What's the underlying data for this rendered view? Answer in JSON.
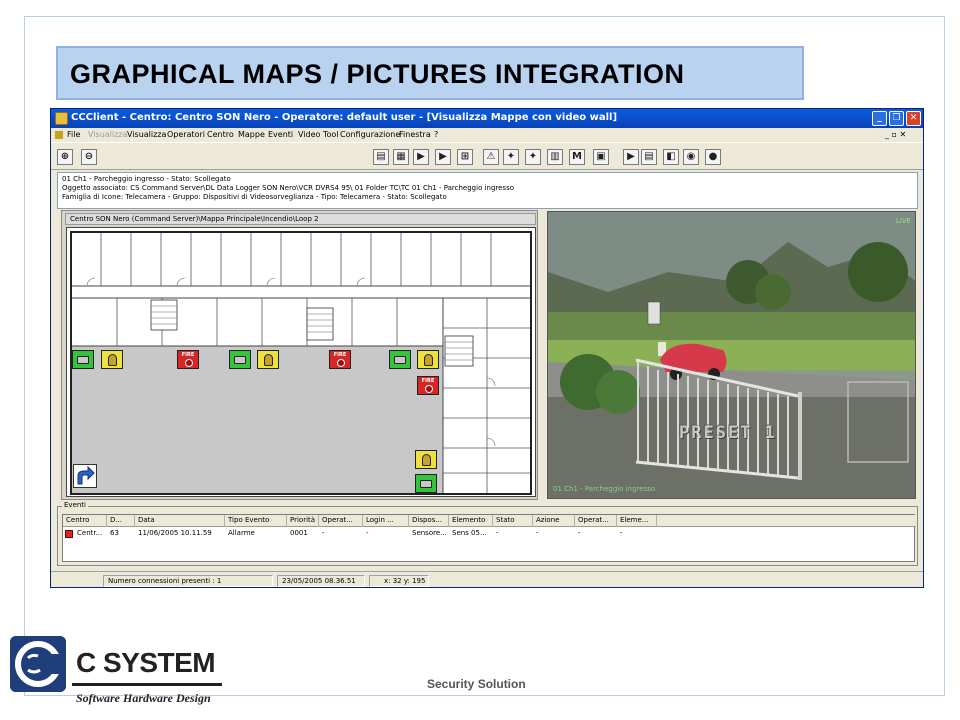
{
  "slide": {
    "title": "GRAPHICAL  MAPS / PICTURES INTEGRATION",
    "footer": "Security  Solution"
  },
  "logo": {
    "brand": "C SYSTEM",
    "tagline": "Software Hardware Design"
  },
  "window": {
    "title": "CCClient - Centro: Centro SON Nero - Operatore: default user - [Visualizza Mappe con video wall]",
    "minimize": "_",
    "restore": "❐",
    "close": "✕"
  },
  "menu": {
    "items": [
      "File",
      "Visualizza",
      "Visualizza",
      "Operatori",
      "Centro",
      "Mappe",
      "Eventi",
      "Video Tool",
      "Configurazione",
      "Finestra",
      "?"
    ],
    "mdi_controls": "_ ▫ ✕"
  },
  "toolbar": {
    "buttons": [
      {
        "icon": "zoom-in-icon",
        "glyph": "⊕"
      },
      {
        "icon": "zoom-out-icon",
        "glyph": "⊖"
      },
      {
        "icon": "document-icon",
        "glyph": "▤"
      },
      {
        "icon": "map-view-icon",
        "glyph": "▦"
      },
      {
        "icon": "camera-group-icon",
        "glyph": "▶"
      },
      {
        "icon": "camera-group-2-icon",
        "glyph": "▶"
      },
      {
        "icon": "grid-icon",
        "glyph": "⊞"
      },
      {
        "icon": "alarm-icon",
        "glyph": "⚠"
      },
      {
        "icon": "camera-alarm-icon",
        "glyph": "✦"
      },
      {
        "icon": "camera-alarm-2-icon",
        "glyph": "✦"
      },
      {
        "icon": "report-icon",
        "glyph": "▥"
      },
      {
        "icon": "ma-icon",
        "glyph": "M"
      },
      {
        "icon": "monitor-icon",
        "glyph": "▣"
      },
      {
        "icon": "play-icon",
        "glyph": "▶"
      },
      {
        "icon": "film-icon",
        "glyph": "▤"
      },
      {
        "icon": "palette-icon",
        "glyph": "◧"
      },
      {
        "icon": "record-icon",
        "glyph": "◉"
      },
      {
        "icon": "sphere-icon",
        "glyph": "●"
      }
    ]
  },
  "info": {
    "lines": [
      "01 Ch1 - Parcheggio ingresso - Stato: Scollegato",
      "Oggetto associato: CS Command Server\\DL Data Logger SON Nero\\VCR DVRS4 95\\ 01 Folder TC\\TC 01 Ch1 - Parcheggio ingresso",
      "Famiglia di Icone: Telecamera - Gruppo: Dispositivi di Videosorveglianza - Tipo: Telecamera - Stato: Scollegato"
    ]
  },
  "map": {
    "breadcrumb": "Centro SON Nero (Command Server)\\Mappa Principale\\Incendio\\Loop 2",
    "fire_label": "FIRE"
  },
  "video": {
    "live_label": "LIVE",
    "preset_label": "PRESET  1",
    "caption": "01 Ch1 - Parcheggio ingresso"
  },
  "events": {
    "legend": "Eventi",
    "columns": [
      "Centro",
      "D...",
      "Data",
      "Tipo Evento",
      "Priorità",
      "Operat...",
      "Login ...",
      "Dispos...",
      "Elemento",
      "Stato",
      "Azione",
      "Operat...",
      "Eleme..."
    ],
    "rows": [
      [
        "Centr...",
        "63",
        "11/06/2005 10.11.59",
        "Allarme",
        "0001",
        "-",
        "-",
        "Sensore...",
        "Sens 05...",
        "-",
        "-",
        "-",
        "-"
      ]
    ]
  },
  "status": {
    "connections": "Numero connessioni presenti : 1",
    "datetime": "23/05/2005 08.36.51",
    "coords": "x: 32 y: 195"
  },
  "colors": {
    "title_bg": "#b8d2f0",
    "cam_ok": "#35c33d",
    "cam_warn": "#ede23c",
    "fire": "#d82626",
    "titlebar": "#0a5ce0"
  }
}
